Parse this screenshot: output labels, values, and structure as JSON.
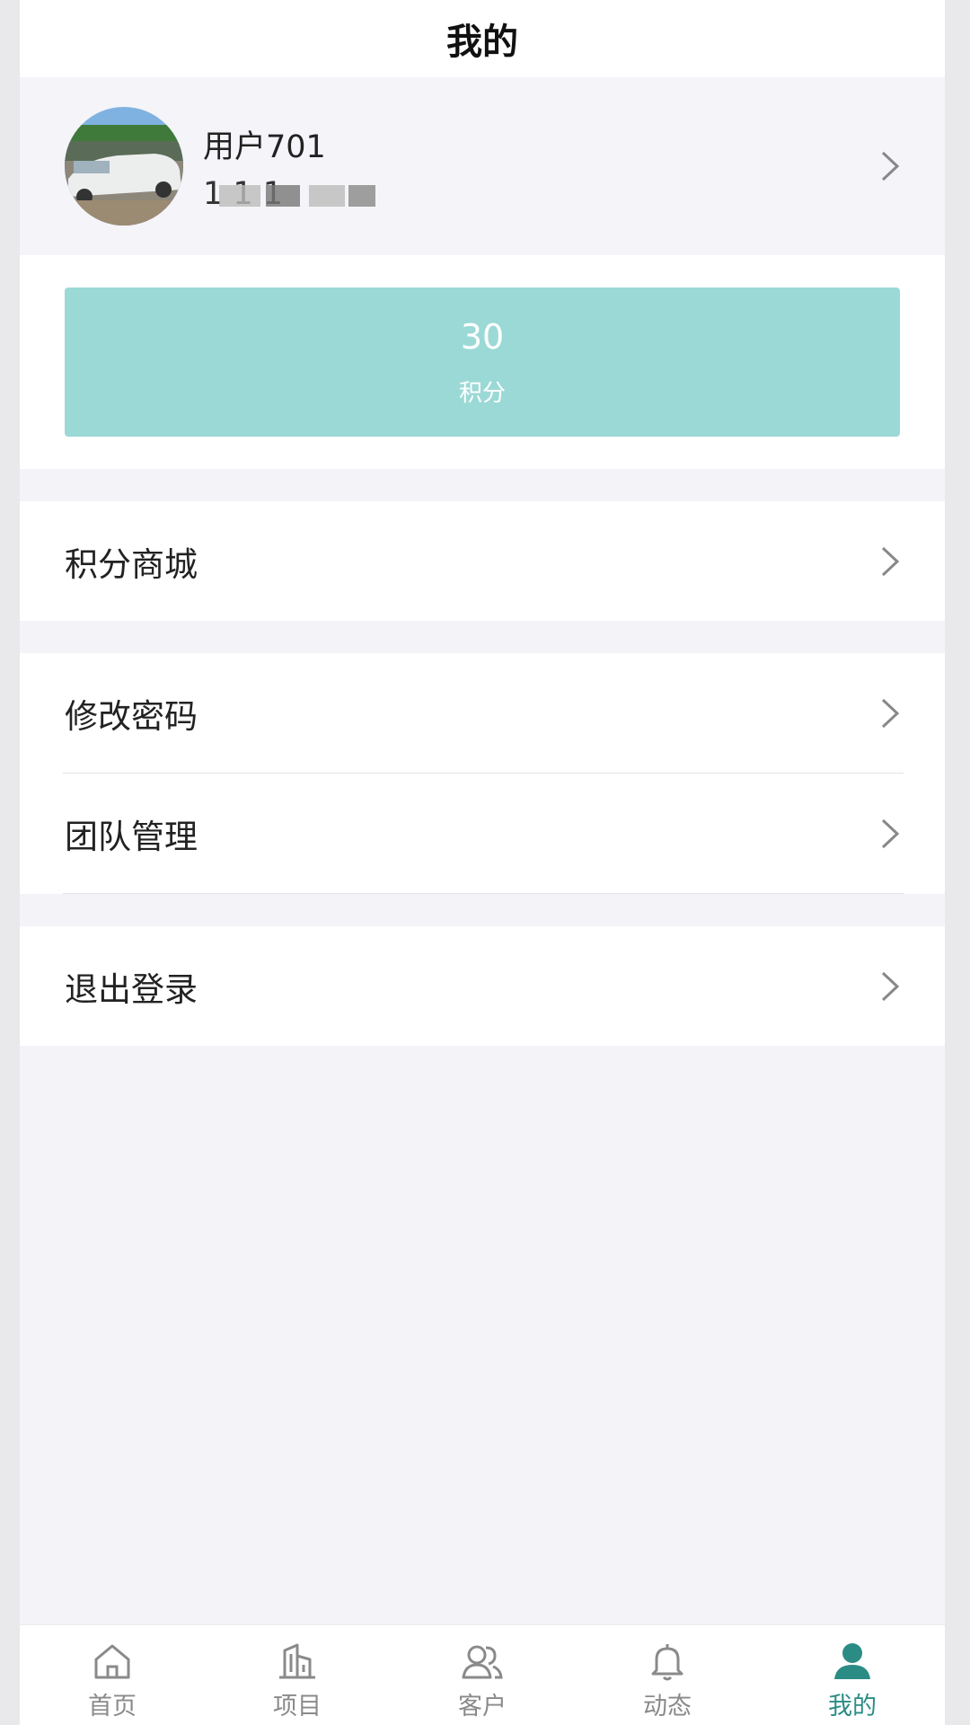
{
  "header": {
    "title": "我的"
  },
  "profile": {
    "name": "用户701",
    "phone": "1       1 1"
  },
  "points": {
    "value": "30",
    "label": "积分"
  },
  "menu": {
    "mall": "积分商城",
    "change_password": "修改密码",
    "team_management": "团队管理",
    "logout": "退出登录"
  },
  "tabs": [
    {
      "label": "首页",
      "icon": "home-icon"
    },
    {
      "label": "项目",
      "icon": "building-icon"
    },
    {
      "label": "客户",
      "icon": "customers-icon"
    },
    {
      "label": "动态",
      "icon": "bell-icon"
    },
    {
      "label": "我的",
      "icon": "user-icon"
    }
  ],
  "colors": {
    "accent": "#2b8c85",
    "points_card": "#9bd9d6",
    "background": "#f3f3f8"
  }
}
